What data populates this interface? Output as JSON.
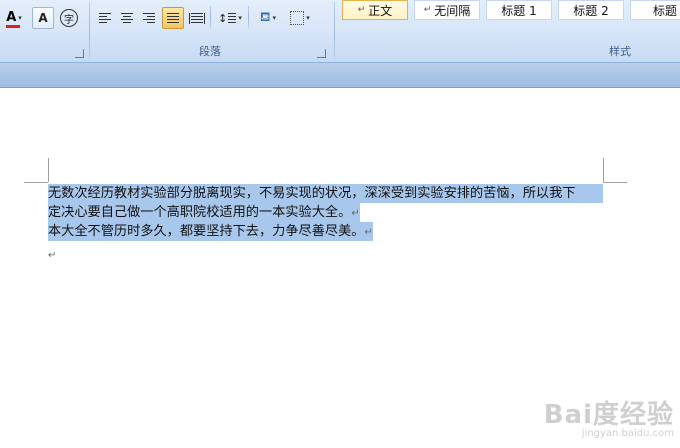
{
  "ribbon": {
    "paragraph_group_label": "段落",
    "styles_group_label": "样式",
    "font_buttons": {
      "highlight_letter": "A",
      "phonetic_letter": "字"
    },
    "styles": [
      {
        "label": "正文",
        "selected": true
      },
      {
        "label": "无间隔",
        "selected": false
      },
      {
        "label": "标题 1",
        "selected": false
      },
      {
        "label": "标题 2",
        "selected": false
      },
      {
        "label": "标题",
        "selected": false
      }
    ],
    "colors": {
      "font_color_bar": "#e51c1c",
      "active_button": "#f6c65e",
      "selection": "#a8c7ec"
    }
  },
  "document": {
    "paragraph_mark": "↵",
    "lines": [
      "无数次经历教材实验部分脱离现实，不易实现的状况，深深受到实验安排的苦恼，所以我下",
      "定决心要自己做一个高职院校适用的一本实验大全。",
      "本大全不管历时多久，都要坚持下去，力争尽善尽美。"
    ]
  },
  "watermark": {
    "logo": "Bai度经验",
    "url": "jingyan.baidu.com"
  }
}
